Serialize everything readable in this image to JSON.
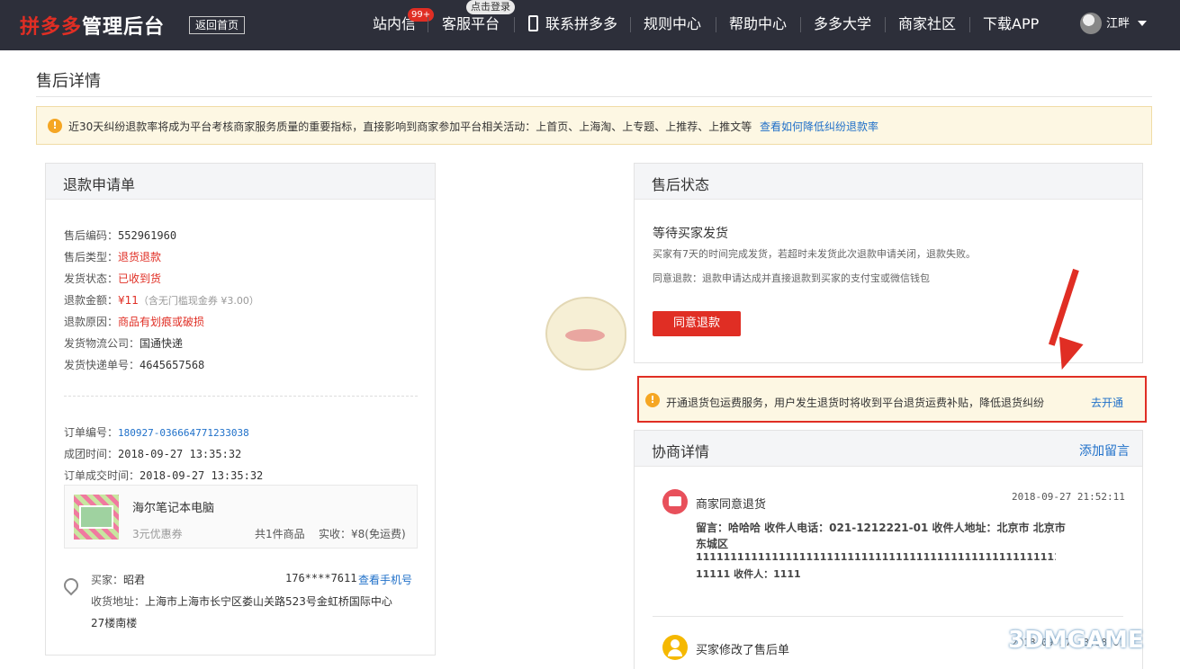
{
  "header": {
    "brand_red": "拼多多",
    "brand_white": "管理后台",
    "home_button": "返回首页",
    "nav": {
      "inbox": "站内信",
      "inbox_badge": "99+",
      "service": "客服平台",
      "service_badge": "点击登录",
      "contact": "联系拼多多",
      "rules": "规则中心",
      "help": "帮助中心",
      "university": "多多大学",
      "community": "商家社区",
      "download": "下载APP"
    },
    "user_name": "江畔"
  },
  "page_title": "售后详情",
  "notice": {
    "text": "近30天纠纷退款率将成为平台考核商家服务质量的重要指标，直接影响到商家参加平台相关活动：上首页、上海淘、上专题、上推荐、上推文等",
    "link": "查看如何降低纠纷退款率"
  },
  "refund_form": {
    "title": "退款申请单",
    "aftersale_no_label": "售后编码：",
    "aftersale_no": "552961960",
    "type_label": "售后类型：",
    "type": "退货退款",
    "ship_status_label": "发货状态：",
    "ship_status": "已收到货",
    "amount_label": "退款金额：",
    "amount": "¥11",
    "amount_note": "（含无门槛现金券 ¥3.00）",
    "reason_label": "退款原因：",
    "reason": "商品有划痕或破损",
    "carrier_label": "发货物流公司：",
    "carrier": "国通快递",
    "tracking_label": "发货快递单号：",
    "tracking": "4645657568",
    "order_no_label": "订单编号：",
    "order_no": "180927-036664771233038",
    "group_time_label": "成团时间：",
    "group_time": "2018-09-27 13:35:32",
    "deal_time_label": "订单成交时间：",
    "deal_time": "2018-09-27 13:35:32",
    "goods": {
      "name": "海尔笔记本电脑",
      "coupon": "3元优惠券",
      "count": "共1件商品",
      "paid": "实收：¥8(免运费)"
    },
    "buyer_label": "买家：",
    "buyer": "昭君",
    "phone": "176****7611",
    "phone_link": "查看手机号",
    "address_label": "收货地址：",
    "address_line1": "上海市上海市长宁区娄山关路523号金虹桥国际中心",
    "address_line2": "27楼南楼"
  },
  "status": {
    "title": "售后状态",
    "state": "等待买家发货",
    "desc": "买家有7天的时间完成发货，若超时未发货此次退款申请关闭，退款失败。",
    "agree_desc": "同意退款：退款申请达成并直接退款到买家的支付宝或微信钱包",
    "agree_button": "同意退款"
  },
  "freight_promo": {
    "text": "开通退货包运费服务，用户发生退货时将收到平台退货运费补贴，降低退货纠纷",
    "link": "去开通"
  },
  "negotiation": {
    "title": "协商详情",
    "add_note": "添加留言",
    "entries": [
      {
        "actor": "商家同意退货",
        "time": "2018-09-27 21:52:11",
        "line1": "留言：哈哈哈 收件人电话：021-1212221-01 收件人地址：北京市 北京市",
        "line2": "东城区",
        "line3": "1111111111111111111111111111111111111111111111111111111111111",
        "line4": "11111 收件人：1111"
      },
      {
        "actor": "买家修改了售后单",
        "time": "2018-09-27 13:38:07"
      }
    ]
  },
  "watermark": "3DMGAME",
  "colors": {
    "brand_red": "#e02e24",
    "topbar": "#2d2f3a",
    "link_blue": "#1f70c9",
    "notice_bg": "#fdf7e3"
  }
}
